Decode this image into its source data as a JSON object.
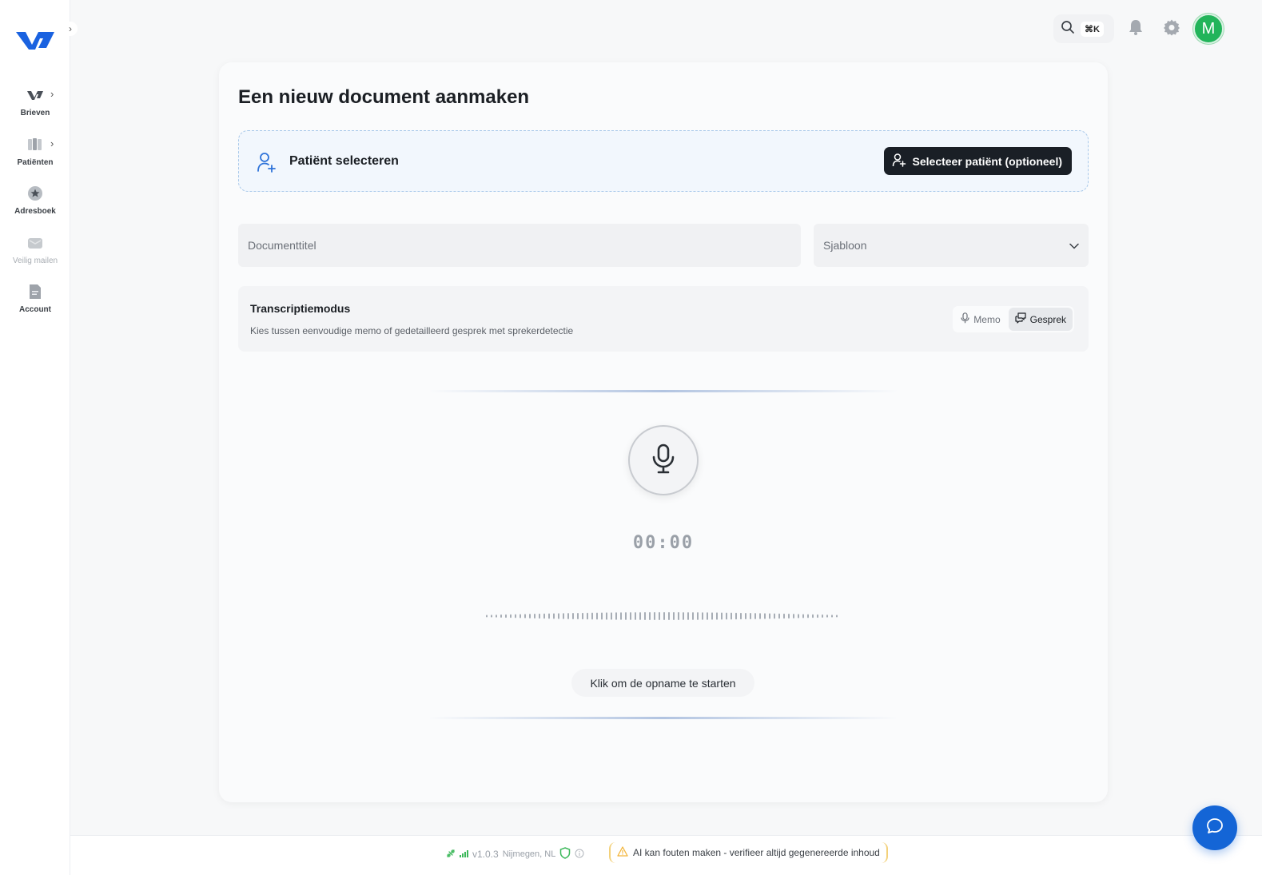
{
  "sidebar": {
    "collapse_icon": "chevron-right-icon",
    "items": [
      {
        "label": "Brieven",
        "icon": "letters-icon",
        "has_submenu": true
      },
      {
        "label": "Patiënten",
        "icon": "patients-icon",
        "has_submenu": true
      },
      {
        "label": "Adresboek",
        "icon": "star-icon",
        "has_submenu": false
      },
      {
        "label": "Veilig mailen",
        "icon": "mail-icon",
        "has_submenu": false,
        "disabled": true
      },
      {
        "label": "Account",
        "icon": "document-icon",
        "has_submenu": false
      }
    ]
  },
  "topbar": {
    "search_shortcut": "⌘K",
    "avatar_initial": "M",
    "avatar_color": "#22b45a"
  },
  "page": {
    "title": "Een nieuw document aanmaken"
  },
  "patient": {
    "label": "Patiënt selecteren",
    "button_label": "Selecteer patiënt (optioneel)"
  },
  "form": {
    "title_placeholder": "Documenttitel",
    "title_value": "",
    "template_placeholder": "Sjabloon"
  },
  "transcription": {
    "title": "Transcriptiemodus",
    "description": "Kies tussen eenvoudige memo of gedetailleerd gesprek met sprekerdetectie",
    "options": [
      {
        "label": "Memo",
        "icon": "microphone-icon",
        "active": false
      },
      {
        "label": "Gesprek",
        "icon": "conversation-icon",
        "active": true
      }
    ]
  },
  "recorder": {
    "timer": "00:00",
    "hint": "Klik om de opname te starten"
  },
  "footer": {
    "version": "v1.0.3",
    "location": "Nijmegen, NL",
    "ai_warning": "AI kan fouten maken - verifieer altijd gegenereerde inhoud"
  },
  "colors": {
    "accent": "#1465d6",
    "dark_button": "#1a1f26",
    "status_green": "#3cb85a",
    "warning": "#f3b53b"
  }
}
